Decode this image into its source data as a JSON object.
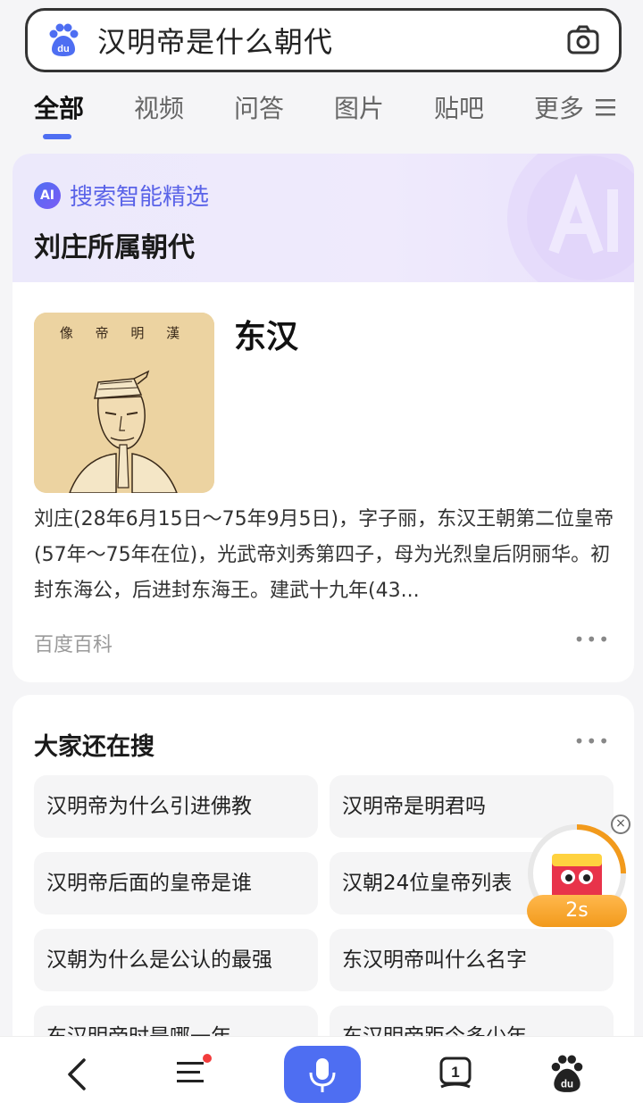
{
  "search": {
    "query": "汉明帝是什么朝代"
  },
  "tabs": [
    {
      "label": "全部"
    },
    {
      "label": "视频"
    },
    {
      "label": "问答"
    },
    {
      "label": "图片"
    },
    {
      "label": "贴吧"
    },
    {
      "label": "更多"
    }
  ],
  "ai_card": {
    "badge": "AI",
    "label": "搜索智能精选",
    "title": "刘庄所属朝代",
    "answer": "东汉",
    "portrait_caption": "像 帝 明 漢",
    "description": "刘庄(28年6月15日～75年9月5日)，字子丽，东汉王朝第二位皇帝(57年～75年在位)，光武帝刘秀第四子，母为光烈皇后阴丽华。初封东海公，后进封东海王。建武十九年(43...",
    "source": "百度百科"
  },
  "related": {
    "title": "大家还在搜",
    "items": [
      "汉明帝为什么引进佛教",
      "汉明帝是明君吗",
      "汉明帝后面的皇帝是谁",
      "汉朝24位皇帝列表",
      "汉朝为什么是公认的最强",
      "东汉明帝叫什么名字",
      "东汉明帝时是哪一年",
      "东汉明帝距今多少年"
    ]
  },
  "reward": {
    "timer": "2s"
  },
  "bottom_bar": {
    "notice_count": "1"
  },
  "colors": {
    "accent": "#4e6ef2",
    "ai_label": "#5a63e8",
    "notification_dot": "#f23c3c"
  }
}
